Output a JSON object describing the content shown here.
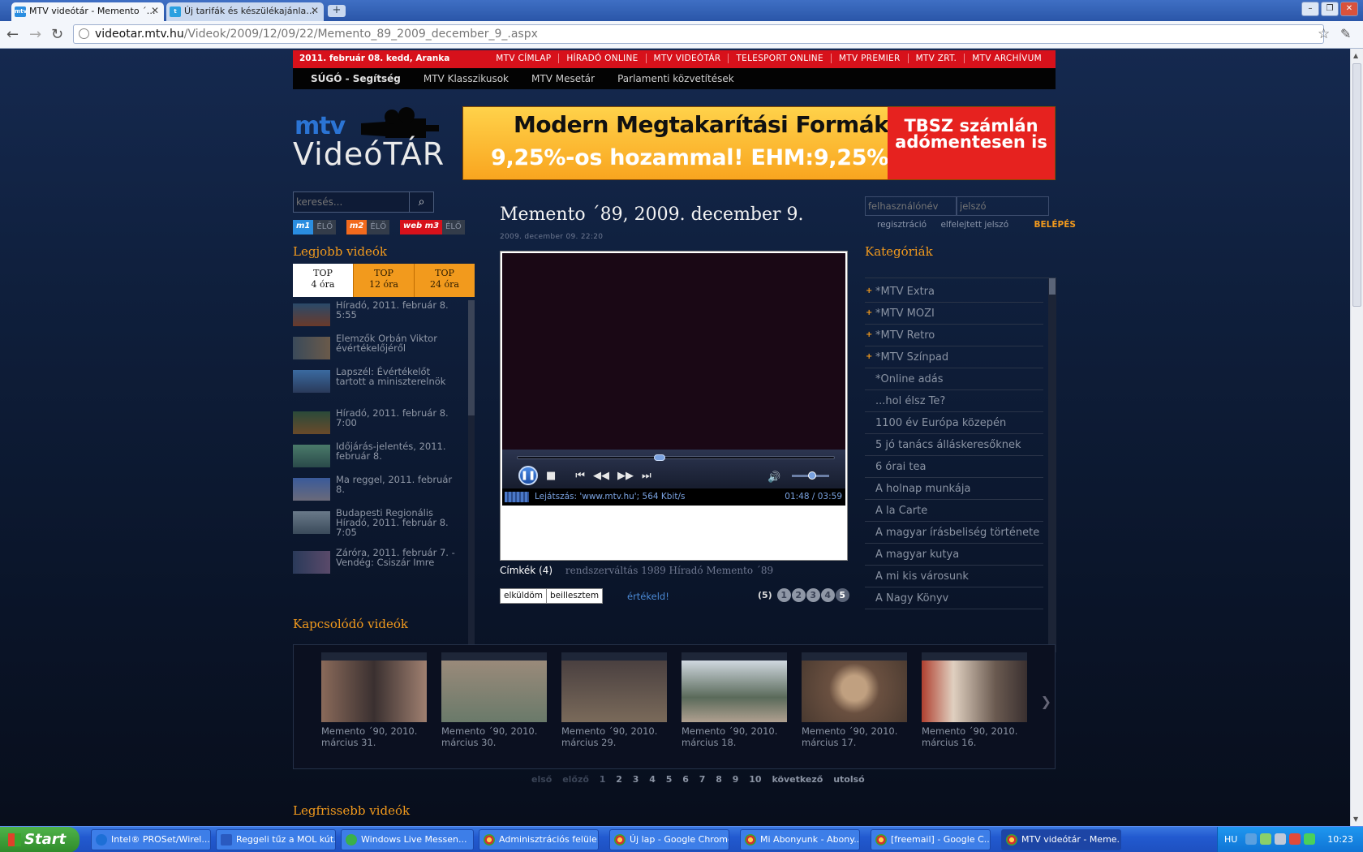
{
  "browser": {
    "tabs": [
      {
        "title": "MTV videótár - Memento ´…",
        "active": true
      },
      {
        "title": "Új tarifák és készülékajánla…",
        "active": false
      }
    ],
    "url_host": "videotar.mtv.hu",
    "url_path": "/Videok/2009/12/09/22/Memento_89_2009_december_9_.aspx",
    "new_tab": "+",
    "win_buttons": [
      "–",
      "❐",
      "✕"
    ]
  },
  "topbar": {
    "date": "2011. február 08. kedd, Aranka",
    "links": [
      "MTV CÍMLAP",
      "HÍRADÓ ONLINE",
      "MTV VIDEÓTÁR",
      "TELESPORT ONLINE",
      "MTV PREMIER",
      "MTV ZRT.",
      "MTV ARCHÍVUM"
    ]
  },
  "subnav": {
    "items": [
      "SÚGÓ - Segítség",
      "MTV Klasszikusok",
      "MTV Mesetár",
      "Parlamenti közvetítések"
    ]
  },
  "logo": {
    "mtv": "mtv",
    "videotar": "VideóTÁR"
  },
  "banner": {
    "line1": "Modern Megtakarítási Formák",
    "line2": "9,25%-os hozammal! EHM:9,25%",
    "right1": "TBSZ számlán",
    "right2": "adómentesen is"
  },
  "search": {
    "placeholder": "keresés...",
    "button_icon": "search-icon"
  },
  "channels": [
    {
      "name": "m1",
      "status": "ÉLŐ",
      "color": "#2a8de0"
    },
    {
      "name": "m2",
      "status": "ÉLŐ",
      "color": "#f26a1d"
    },
    {
      "name": "web m3",
      "status": "ÉLŐ",
      "color": "#d7111b"
    }
  ],
  "best": {
    "title": "Legjobb videók",
    "tabs": [
      {
        "l1": "TOP",
        "l2": "4 óra"
      },
      {
        "l1": "TOP",
        "l2": "12 óra"
      },
      {
        "l1": "TOP",
        "l2": "24 óra"
      }
    ],
    "items": [
      "Híradó, 2011. február 8. 5:55",
      "Elemzők Orbán Viktor évértékelőjéről",
      "Lapszél: Évértékelőt tartott a miniszterelnök",
      "Híradó, 2011. február 8. 7:00",
      "Időjárás-jelentés, 2011. február 8.",
      "Ma reggel, 2011. február 8.",
      "Budapesti Regionális Híradó, 2011. február 8. 7:05",
      "Záróra, 2011. február 7. - Vendég: Csiszár Imre"
    ]
  },
  "video": {
    "title": "Memento ´89, 2009. december 9.",
    "date": "2009. december 09. 22:20",
    "status": "Lejátszás: 'www.mtv.hu'; 564 Kbit/s",
    "time": "01:48 / 03:59",
    "progress": 0.45,
    "volume": 0.55,
    "tags_label": "Címkék (4)",
    "tags": "rendszerváltás 1989 Híradó Memento ´89",
    "send_btn": "elküldöm",
    "embed_btn": "beillesztem",
    "rate_link": "értékeld!",
    "rating_count": "(5)",
    "rating_dots": [
      "1",
      "2",
      "3",
      "4",
      "5"
    ]
  },
  "login": {
    "user_placeholder": "felhasználónév",
    "pass_placeholder": "jelszó",
    "register": "regisztráció",
    "forgot": "elfelejtett jelszó",
    "login": "BELÉPÉS"
  },
  "categories": {
    "title": "Kategóriák",
    "items": [
      {
        "label": "*MTV Extra",
        "plus": true
      },
      {
        "label": "*MTV MOZI",
        "plus": true
      },
      {
        "label": "*MTV Retro",
        "plus": true
      },
      {
        "label": "*MTV Színpad",
        "plus": true
      },
      {
        "label": "*Online adás",
        "plus": false
      },
      {
        "label": "...hol élsz Te?",
        "plus": false
      },
      {
        "label": "1100 év Európa közepén",
        "plus": false
      },
      {
        "label": "5 jó tanács álláskeresőknek",
        "plus": false
      },
      {
        "label": "6 órai tea",
        "plus": false
      },
      {
        "label": "A holnap munkája",
        "plus": false
      },
      {
        "label": "A la Carte",
        "plus": false
      },
      {
        "label": "A magyar írásbeliség története",
        "plus": false
      },
      {
        "label": "A magyar kutya",
        "plus": false
      },
      {
        "label": "A mi kis városunk",
        "plus": false
      },
      {
        "label": "A Nagy Könyv",
        "plus": false
      }
    ]
  },
  "related": {
    "title": "Kapcsolódó videók",
    "items": [
      {
        "l1": "Memento ´90, 2010.",
        "l2": "március 31."
      },
      {
        "l1": "Memento ´90, 2010.",
        "l2": "március 30."
      },
      {
        "l1": "Memento ´90, 2010.",
        "l2": "március 29."
      },
      {
        "l1": "Memento ´90, 2010.",
        "l2": "március 18."
      },
      {
        "l1": "Memento ´90, 2010.",
        "l2": "március 17."
      },
      {
        "l1": "Memento ´90, 2010.",
        "l2": "március 16."
      }
    ]
  },
  "pager": {
    "first": "első",
    "prev": "előző",
    "pages": [
      "1",
      "2",
      "3",
      "4",
      "5",
      "6",
      "7",
      "8",
      "9",
      "10"
    ],
    "next": "következő",
    "last": "utolsó"
  },
  "latest": {
    "title": "Legfrissebb videók"
  },
  "taskbar": {
    "start": "Start",
    "items": [
      "Intel® PROSet/Wirel...",
      "Reggeli tűz a MOL kút...",
      "Windows Live Messen...",
      "Adminisztrációs felüle...",
      "Új lap - Google Chrome",
      "Mi Abonyunk - Abony...",
      "[freemail] - Google C...",
      "MTV videótár - Meme..."
    ],
    "lang": "HU",
    "clock": "10:23"
  }
}
